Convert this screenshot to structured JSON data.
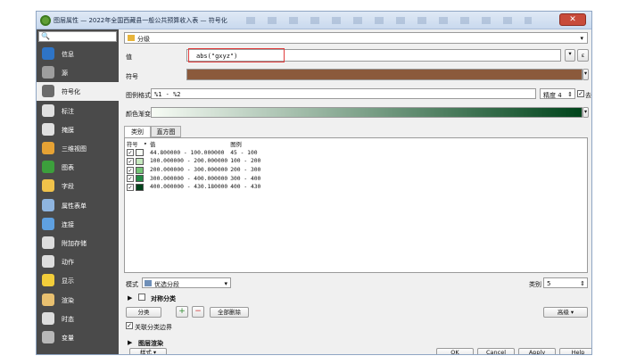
{
  "window": {
    "title": "图层属性 — 2022年全国西藏县一般公共预算收入表 — 符号化",
    "close_glyph": "✕"
  },
  "sidebar": {
    "search_glyph": "🔍",
    "items": [
      {
        "label": "信息",
        "color": "#2e74c6"
      },
      {
        "label": "源",
        "color": "#9e9e9e"
      },
      {
        "label": "符号化",
        "color": "#6b6b6b"
      },
      {
        "label": "标注",
        "color": "#e0e0e0"
      },
      {
        "label": "掩膜",
        "color": "#e0e0e0"
      },
      {
        "label": "三维视图",
        "color": "#e6a234"
      },
      {
        "label": "图表",
        "color": "#3c9f3c"
      },
      {
        "label": "字段",
        "color": "#f0c24a"
      },
      {
        "label": "属性表单",
        "color": "#8fb5e0"
      },
      {
        "label": "连接",
        "color": "#5fa0e0"
      },
      {
        "label": "附加存储",
        "color": "#dddddd"
      },
      {
        "label": "动作",
        "color": "#dddddd"
      },
      {
        "label": "显示",
        "color": "#f2cd3a"
      },
      {
        "label": "渲染",
        "color": "#e8c070"
      },
      {
        "label": "时态",
        "color": "#dddddd"
      },
      {
        "label": "变量",
        "color": "#b8b8b8"
      }
    ]
  },
  "renderer": {
    "type": "分级"
  },
  "value_field": {
    "label": "值",
    "value": "abs(\"gxyz\")",
    "epsilon": "ε"
  },
  "symbol": {
    "label": "符号",
    "color": "#8b5a3c"
  },
  "legend_format": {
    "label": "图例格式",
    "value": "%1 - %2",
    "precision_label": "精度 4",
    "trim_label": "去除"
  },
  "color_ramp": {
    "label": "颜色渐变",
    "start": "#f7fcf5",
    "end": "#00441b"
  },
  "tabs": {
    "classes": "类别",
    "histogram": "直方图"
  },
  "class_table": {
    "headers": {
      "symbol": "符号",
      "value": "值",
      "legend": "图例"
    },
    "rows": [
      {
        "value": "44.800000 - 100.000000",
        "legend": "45 - 100",
        "color": "#f7fcf5"
      },
      {
        "value": "100.000000 - 200.000000",
        "legend": "100 - 200",
        "color": "#c7e9c0"
      },
      {
        "value": "200.000000 - 300.000000",
        "legend": "200 - 300",
        "color": "#74c476"
      },
      {
        "value": "300.000000 - 400.000000",
        "legend": "300 - 400",
        "color": "#238b45"
      },
      {
        "value": "400.000000 - 430.180000",
        "legend": "400 - 430",
        "color": "#00441b"
      }
    ]
  },
  "mode": {
    "label": "模式",
    "value": "优选分段",
    "classes_label": "类别",
    "classes_value": "5"
  },
  "symmetric": {
    "label": "对称分类"
  },
  "buttons": {
    "classify": "分类",
    "delete_all": "全部删除",
    "advanced": "高级",
    "ok": "OK",
    "cancel": "Cancel",
    "apply": "Apply",
    "help": "Help",
    "style": "样式"
  },
  "link_bounds": {
    "label": "关联分类边界"
  },
  "layer_render": {
    "label": "图层渲染"
  }
}
